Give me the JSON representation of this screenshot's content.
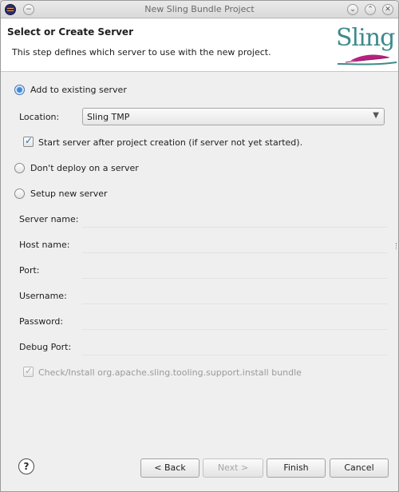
{
  "window": {
    "title": "New Sling Bundle Project"
  },
  "header": {
    "title": "Select or Create Server",
    "description": "This step defines which server to use with the new project.",
    "logo_text": "Sling"
  },
  "options": {
    "existing": {
      "label": "Add to existing server",
      "selected": true
    },
    "no_deploy": {
      "label": "Don't deploy on a server",
      "selected": false
    },
    "new_server": {
      "label": "Setup new server",
      "selected": false
    }
  },
  "location": {
    "label": "Location:",
    "value": "Sling TMP"
  },
  "start_server": {
    "label": "Start server after project creation (if server not yet started).",
    "checked": true
  },
  "new_server_fields": [
    {
      "label": "Server name:",
      "value": ""
    },
    {
      "label": "Host name:",
      "value": ""
    },
    {
      "label": "Port:",
      "value": ""
    },
    {
      "label": "Username:",
      "value": ""
    },
    {
      "label": "Password:",
      "value": ""
    },
    {
      "label": "Debug Port:",
      "value": ""
    }
  ],
  "install_bundle": {
    "label": "Check/Install org.apache.sling.tooling.support.install bundle",
    "checked": true,
    "enabled": false
  },
  "buttons": {
    "help": "?",
    "back": "< Back",
    "next": "Next >",
    "finish": "Finish",
    "cancel": "Cancel"
  },
  "colors": {
    "accent": "#3b8be0",
    "logo": "#3d8a8c"
  }
}
